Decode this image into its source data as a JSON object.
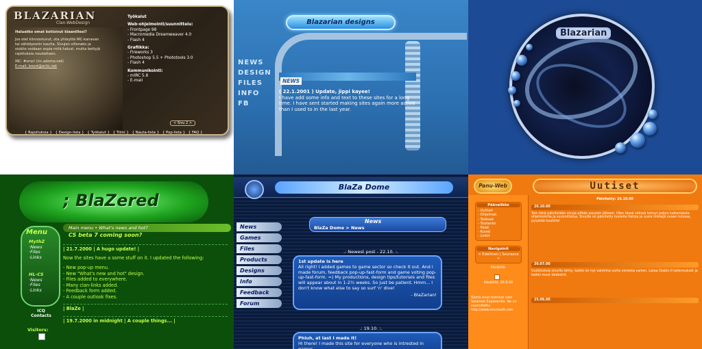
{
  "panel1": {
    "logo": "BLAZARIAN",
    "subtitle": "Clan-WebDesign",
    "left_paragraphs": [
      "Haluatko omat kotisivut klaanillesi?",
      "Jos olet kiinnostunut, ota yhteyttä IRC-kanavan tai sähköpostin kautta. Sivujen sillonako ja sisälto voidaan sopia mitä halust, mutta bettyjä rajoituksia noudattaen.",
      "IRC: #smo! (irc.adome.net)",
      "E-mail: boost@artic.net"
    ],
    "right_lines": [
      {
        "text": "Työkalut",
        "head": true
      },
      {
        "text": "Web-ohjelmointi/suunnittelu:",
        "head": true
      },
      {
        "text": "- Frontpage 98",
        "head": false
      },
      {
        "text": "- Macromedia Dreamweaver 4.0",
        "head": false
      },
      {
        "text": "- Flash 4",
        "head": false
      },
      {
        "text": "Grafiikka:",
        "head": true
      },
      {
        "text": "- Fireworks 3",
        "head": false
      },
      {
        "text": "- Photoshop 5.5 + Phototools 3.0",
        "head": false
      },
      {
        "text": "- Flash 4",
        "head": false
      },
      {
        "text": "Kommunikointi:",
        "head": true
      },
      {
        "text": "- mIRC 5.8",
        "head": false
      },
      {
        "text": "- E-mail",
        "head": false
      }
    ],
    "page_label": "< Sivu 2 >",
    "nav": [
      "{ Rajoituksia }",
      "{ Design-lista }",
      "{ Työkalut }",
      "{ Tiimi }",
      "{ Nauta-lista }",
      "{ Pop-lista }",
      "{ FAQ }"
    ]
  },
  "panel2": {
    "logo": "Blazarian designs",
    "nav": [
      "NEWS",
      "DESIGN",
      "FILES",
      "INFO",
      "FB"
    ],
    "news_label": "NEWS",
    "post_title": "( 22.1.2001 ) Update, jippi kayee!",
    "post_body": "I have add some info and text to these sites for a long time. I have sent started making sites again more active than I used to in the last year."
  },
  "panel3": {
    "logo": "Blazarian"
  },
  "panel4": {
    "logo": "; BlaZered",
    "menu_title": "Menu",
    "menu_items": [
      "MythZ",
      "·News",
      "·Files",
      "·Links",
      "HL-CS",
      "·News",
      "·Files",
      "·Links"
    ],
    "top_nav": "Main menu • What's news and hot?",
    "banner": "CS beta 7 coming soon?",
    "ico_label": "ICQ Contacts",
    "visitors_label": "Visitors:",
    "post1_date": "| 21.7.2000 | A hugo update! |",
    "post1_body": "Now the sites have a some stuff on it. I updated the following:",
    "post1_list": [
      "- New pop-up menu.",
      "- New \"What's new and hot\" design.",
      "- Files added to everywhere.",
      "- Many clan-links added.",
      "- Feedback form added.",
      "- A couple outlook fixes."
    ],
    "signature": "| BlaZe |",
    "post2_date": "| 19.7.2000 in midnight | A couple things... |"
  },
  "panel5": {
    "title": "BlaZa Dome",
    "nav": [
      "News",
      "Games",
      "Files",
      "Products",
      "Designs",
      "Info",
      "Feedback",
      "Forum"
    ],
    "news_title": "News",
    "breadcrumb": "BlaZa Dome > News",
    "newest_label": ".: Newest post - 22.10. :.",
    "post1_title": "1st update is here",
    "post1_body": "All right! I added games to game sector so check it out. And i made forum, feedback pop-up-fast-form and game voting pop-up-fast-form. =) My productions, design tips/tutorials and files will appear about in 1-2½ weeks. So just be patient. Hmm... I don't know what else to say so surf 'n' dive!",
    "post1_sig": "- BlaZarian!",
    "post2_label": ".: 19.10. :.",
    "post2_title": "Phiuh, at last I made it!",
    "post2_body": "Hi there! I made this site for everyone who is intrested in games,"
  },
  "panel6": {
    "logo": "Panu-Web",
    "title": "Uutiset",
    "updated": "Päivitetty: 26.10.00",
    "nav_box_title": "Päävalikko",
    "nav_items": [
      "- Uutiset",
      "- Ohjelmat",
      "- Teokset",
      "- Tuotanto",
      "- Palat",
      "- Kuvat",
      "- Linkit"
    ],
    "navigate_title": "Navigoinit",
    "navigate_links": "< Edellinen | Seuraava >",
    "visitors_label": "Kävijöitä:",
    "visitors_since": "Kävijöitä: 26.9.00",
    "side_text": "Nämä sivut toimivat vain Selaimet Explorerilla. Ne on suunniteltu: http://www.microsoft.com",
    "posts": [
      {
        "date": "26.10.00",
        "body": "Tein tänä päivitetään sivuja pitkän paussin jälkeen. Olen tässä välissä tehnyt paljon kaikenlaista ohjelmointia ja suunnittelua. Sivuille on päivitetty tuoreita tietoja ja uusia linkkejä ovaan tulossa, pysykää kuulolla!"
      },
      {
        "date": "30.07.00",
        "body": "Uudistuksia sivuilla tehty, kaikki on nyt valmiina uutta versiota varten. Lataa Diablo II tallennukset ja kaikki muut tiedostot."
      },
      {
        "date": "25.06.00",
        "body": ""
      }
    ]
  }
}
